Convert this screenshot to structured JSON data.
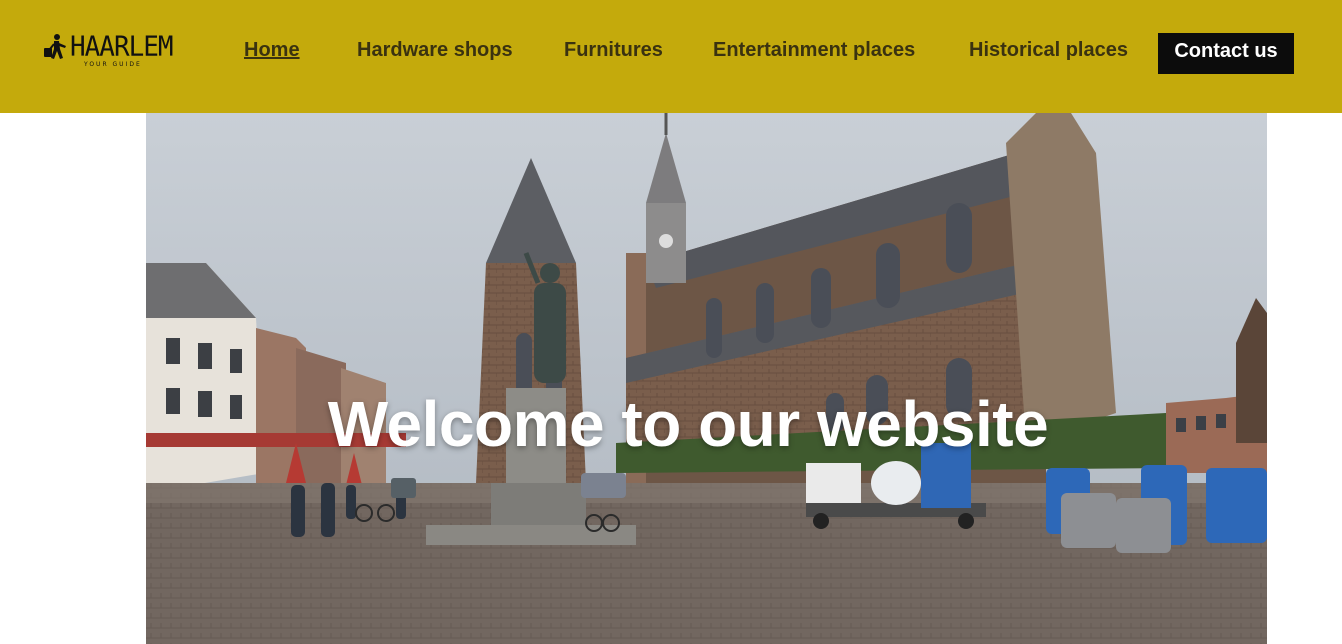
{
  "brand": {
    "name": "HAARLEM",
    "tagline": "YOUR GUIDE",
    "icon": "traveler-with-luggage-icon"
  },
  "nav": {
    "items": [
      {
        "label": "Home",
        "active": true
      },
      {
        "label": "Hardware shops",
        "active": false
      },
      {
        "label": "Furnitures",
        "active": false
      },
      {
        "label": "Entertainment places",
        "active": false
      },
      {
        "label": "Historical places",
        "active": false
      }
    ],
    "contact_label": "Contact us"
  },
  "hero": {
    "title": "Welcome to our website",
    "image_subject": "Grote Kerk cathedral on Grote Markt square, Haarlem, with statue of Laurens Janszoon Coster"
  },
  "colors": {
    "navbar": "#c4aa0c",
    "nav_text": "#3a3210",
    "contact_bg": "#0c0c0c",
    "contact_text": "#ffffff",
    "hero_title": "#ffffff"
  }
}
